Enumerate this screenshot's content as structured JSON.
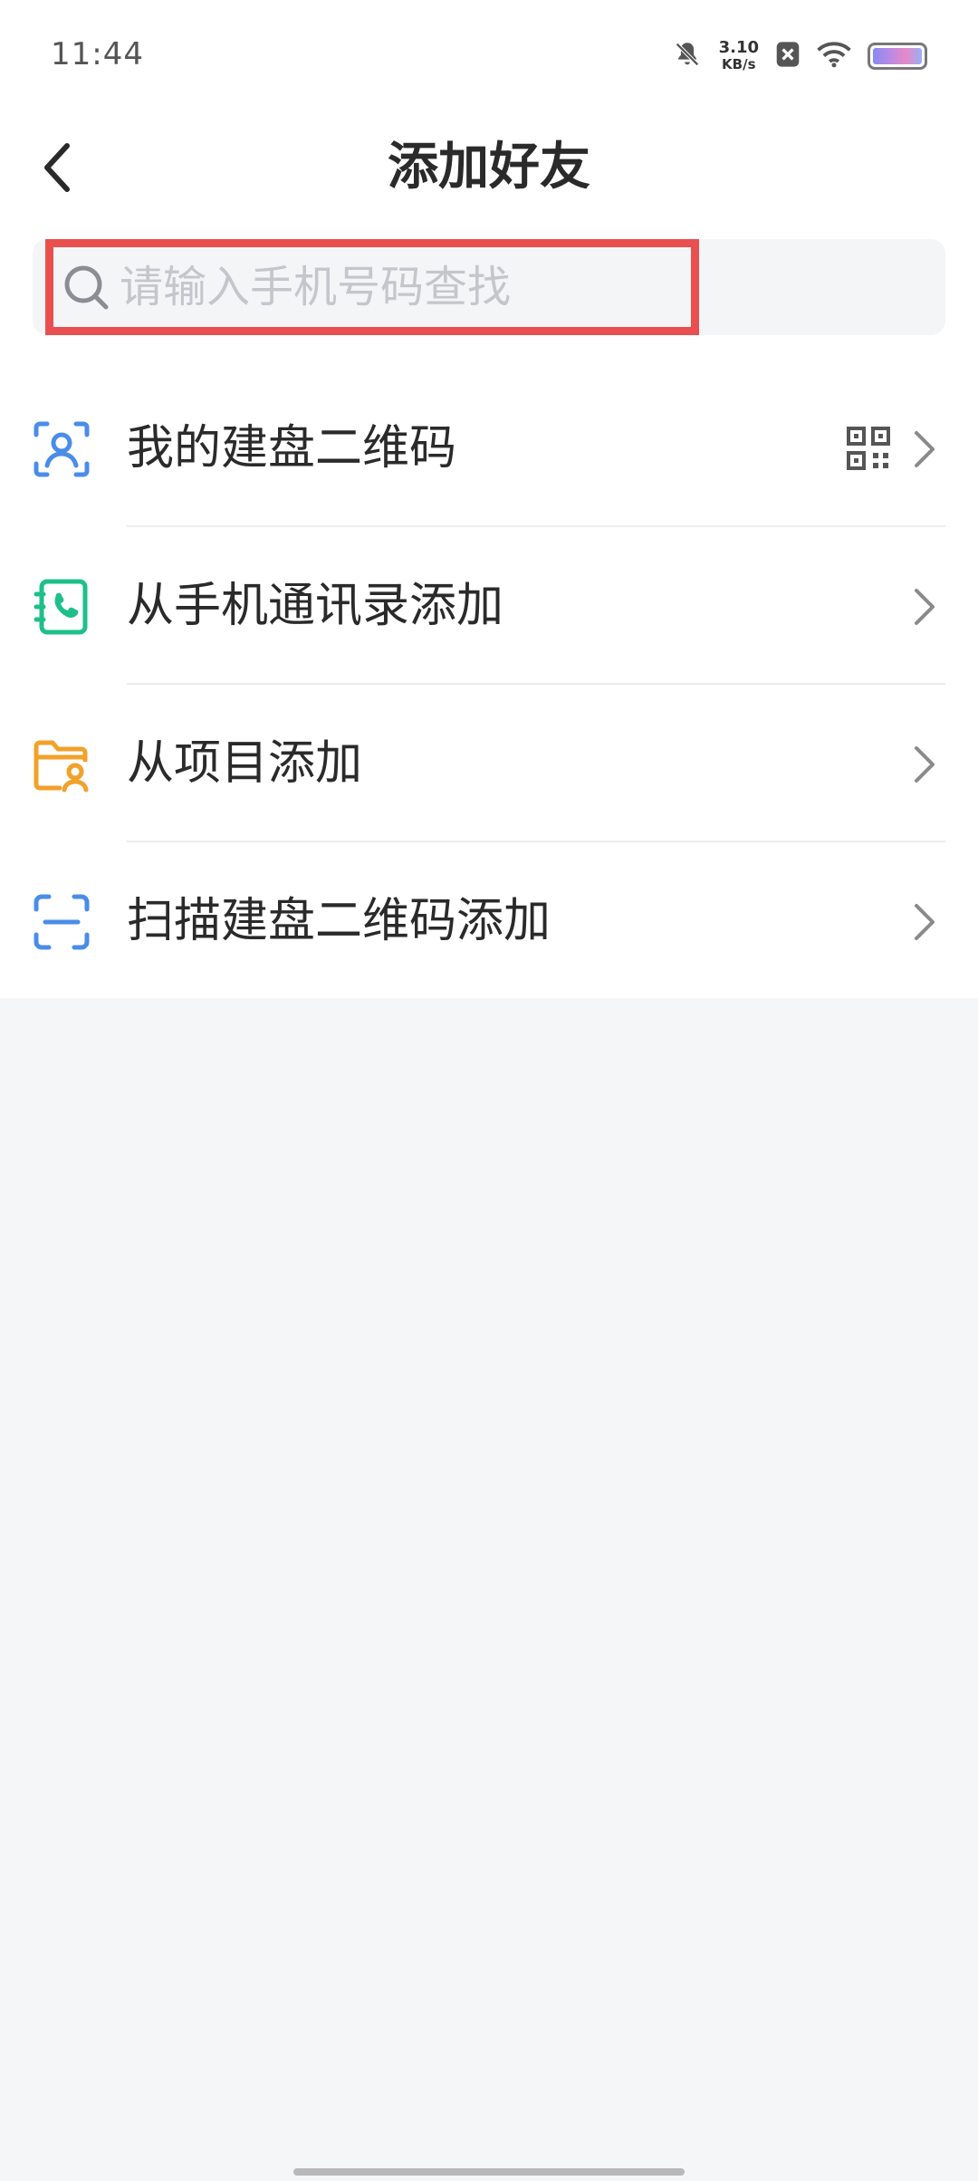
{
  "status_bar": {
    "time": "11:44",
    "net_speed_value": "3.10",
    "net_speed_unit": "KB/s",
    "icons": [
      "bell-off-icon",
      "close-badge-icon",
      "wifi-icon",
      "battery-icon"
    ]
  },
  "header": {
    "title": "添加好友",
    "back_icon": "chevron-left-icon"
  },
  "search": {
    "placeholder": "请输入手机号码查找",
    "value": "",
    "icon": "search-icon"
  },
  "menu": {
    "items": [
      {
        "label": "我的建盘二维码",
        "icon": "user-scan-icon",
        "icon_color": "#4a8de8",
        "trailing_icon": "qr-code-icon"
      },
      {
        "label": "从手机通讯录添加",
        "icon": "contact-book-icon",
        "icon_color": "#1fbf8a"
      },
      {
        "label": "从项目添加",
        "icon": "project-folder-icon",
        "icon_color": "#f2a12b"
      },
      {
        "label": "扫描建盘二维码添加",
        "icon": "scan-icon",
        "icon_color": "#4a8de8"
      }
    ]
  },
  "colors": {
    "highlight_border": "#e94f4f",
    "background": "#f5f6f8"
  }
}
